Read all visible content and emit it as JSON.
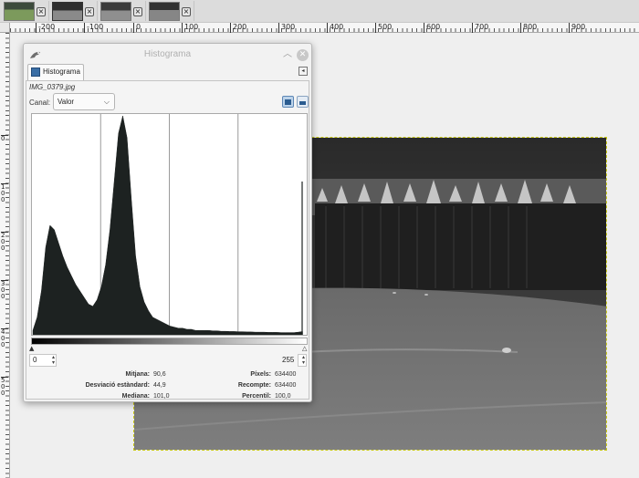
{
  "image_tabs": [
    {
      "name": "tab-1",
      "close": "×"
    },
    {
      "name": "tab-2",
      "close": "×"
    },
    {
      "name": "tab-3",
      "close": "×"
    },
    {
      "name": "tab-4",
      "close": "×"
    }
  ],
  "ruler": {
    "h_labels": [
      "-200",
      "-100",
      "0",
      "100",
      "200",
      "300",
      "400",
      "500",
      "600",
      "700",
      "800",
      "900"
    ],
    "v_labels": [
      "0",
      "100",
      "200",
      "300",
      "400",
      "500"
    ]
  },
  "dialog": {
    "title": "Histograma",
    "tab_label": "Histograma",
    "image_name": "IMG_0379.jpg",
    "canal_label": "Canal:",
    "canal_value": "Valor",
    "range_min": "0",
    "range_max": "255",
    "stats": {
      "mitjana_label": "Mitjana:",
      "mitjana": "90,6",
      "desviacio_label": "Desviació estàndard:",
      "desviacio": "44,9",
      "mediana_label": "Mediana:",
      "mediana": "101,0",
      "pixels_label": "Píxels:",
      "pixels": "634400",
      "recompte_label": "Recompte:",
      "recompte": "634400",
      "percentil_label": "Percentil:",
      "percentil": "100,0"
    }
  },
  "icons": {
    "window": "wilber-icon",
    "minimize": "chevron-up-icon",
    "close": "close-icon",
    "tab": "histogram-icon",
    "tab_menu": "tab-menu-icon",
    "linear": "linear-histogram-icon",
    "log": "log-histogram-icon"
  },
  "colors": {
    "histogram_fill": "#1d2221",
    "selection_border": "#c8c816"
  },
  "chart_data": {
    "type": "area",
    "title": "",
    "xlabel": "",
    "ylabel": "",
    "xlim": [
      0,
      255
    ],
    "x": [
      0,
      4,
      8,
      12,
      16,
      20,
      24,
      28,
      32,
      36,
      40,
      44,
      48,
      52,
      56,
      60,
      64,
      68,
      72,
      76,
      80,
      84,
      88,
      92,
      96,
      100,
      104,
      108,
      112,
      116,
      120,
      124,
      128,
      132,
      136,
      140,
      144,
      148,
      152,
      156,
      160,
      164,
      168,
      172,
      176,
      180,
      184,
      188,
      192,
      196,
      200,
      204,
      208,
      212,
      216,
      220,
      224,
      228,
      232,
      236,
      240,
      244,
      248,
      252,
      255
    ],
    "values": [
      2,
      8,
      20,
      40,
      50,
      48,
      42,
      36,
      31,
      27,
      23,
      20,
      17,
      14,
      13,
      16,
      22,
      32,
      48,
      70,
      92,
      100,
      90,
      62,
      36,
      22,
      15,
      11,
      8,
      7,
      6,
      5,
      4,
      3.5,
      3,
      3,
      2.5,
      2.5,
      2,
      2,
      2,
      2,
      1.8,
      1.8,
      1.6,
      1.6,
      1.5,
      1.5,
      1.4,
      1.4,
      1.3,
      1.3,
      1.2,
      1.2,
      1.2,
      1.1,
      1.1,
      1.1,
      1,
      1,
      1,
      1,
      1.2,
      1.5,
      70
    ],
    "grid": "vertical lines at quarter intervals"
  }
}
